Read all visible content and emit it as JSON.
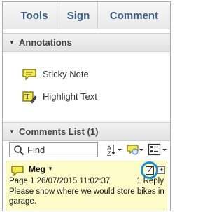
{
  "tabs": [
    {
      "label": "Tools"
    },
    {
      "label": "Sign"
    },
    {
      "label": "Comment"
    }
  ],
  "annotations": {
    "title": "Annotations",
    "tools": [
      {
        "label": "Sticky Note",
        "icon": "sticky-note-icon"
      },
      {
        "label": "Highlight Text",
        "icon": "highlight-text-icon"
      }
    ]
  },
  "comments": {
    "title": "Comments List (1)",
    "search_value": "Find",
    "items": [
      {
        "author": "Meg",
        "meta": "Page 1  26/07/2015 11:02:37",
        "reply": "1 Reply",
        "body": "Please show where we would store bikes in garage.",
        "checked": true
      }
    ]
  },
  "colors": {
    "tab_text": "#3b5f87",
    "comment_bg": "#fdfbc8",
    "highlight_ring": "#1c8fd1"
  }
}
